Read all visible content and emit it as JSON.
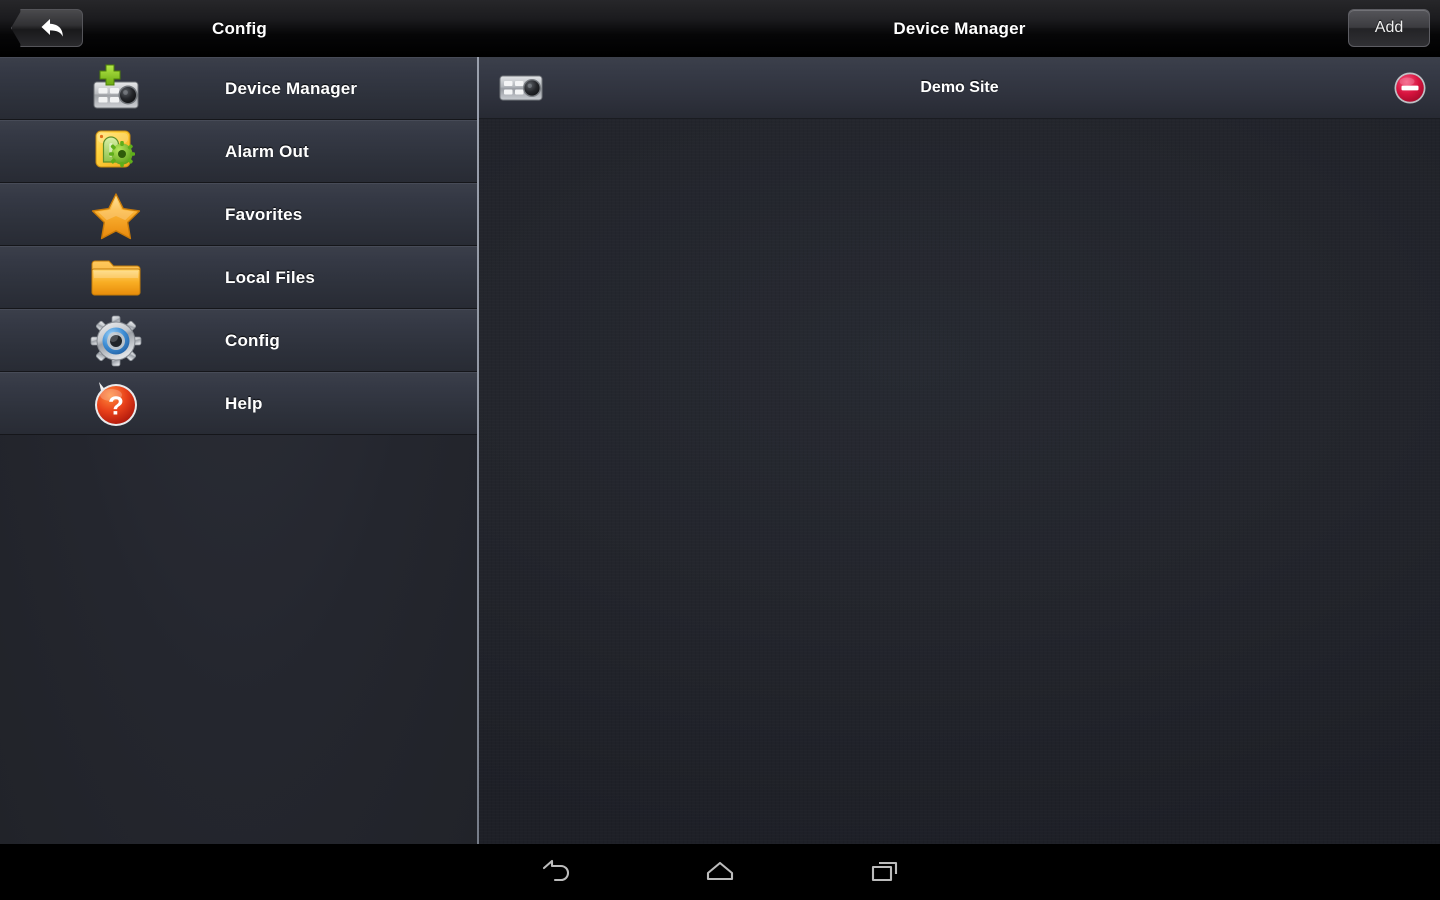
{
  "left_panel": {
    "titlebar": {
      "title": "Config",
      "back_icon": "back-arrow-icon"
    },
    "menu_items": [
      {
        "label": "Device Manager",
        "icon": "dvr-add-icon"
      },
      {
        "label": "Alarm Out",
        "icon": "alarm-out-icon"
      },
      {
        "label": "Favorites",
        "icon": "star-icon"
      },
      {
        "label": "Local Files",
        "icon": "folder-icon"
      },
      {
        "label": "Config",
        "icon": "gear-icon"
      },
      {
        "label": "Help",
        "icon": "question-bubble-icon"
      }
    ]
  },
  "right_panel": {
    "titlebar": {
      "title": "Device Manager",
      "add_label": "Add"
    },
    "devices": [
      {
        "name": "Demo Site",
        "icon": "dvr-icon",
        "delete_icon": "delete-minus-icon"
      }
    ]
  },
  "navbar": {
    "buttons": [
      {
        "name": "back",
        "icon": "android-back-icon"
      },
      {
        "name": "home",
        "icon": "android-home-icon"
      },
      {
        "name": "recent",
        "icon": "android-recents-icon"
      }
    ]
  },
  "colors": {
    "accent_red": "#d8143f",
    "panel_bg": "#272a33",
    "row_top": "#3b3f4a",
    "titlebar_bg": "#1b1b1e",
    "text": "#ffffff",
    "divider": "#9aa0ad"
  }
}
